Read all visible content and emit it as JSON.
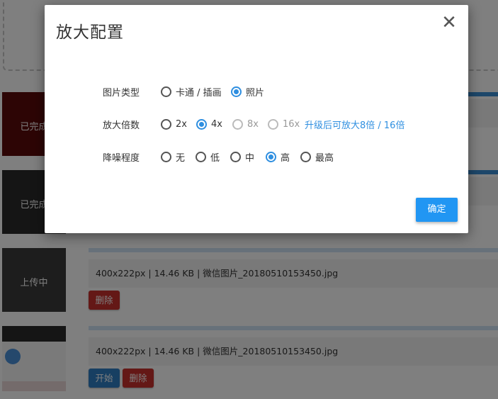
{
  "dialog": {
    "title": "放大配置",
    "close_icon": "close-icon",
    "confirm_label": "确定",
    "rows": {
      "type": {
        "label": "图片类型",
        "options": [
          {
            "text": "卡通 / 插画",
            "checked": false,
            "disabled": false
          },
          {
            "text": "照片",
            "checked": true,
            "disabled": false
          }
        ]
      },
      "scale": {
        "label": "放大倍数",
        "options": [
          {
            "text": "2x",
            "checked": false,
            "disabled": false
          },
          {
            "text": "4x",
            "checked": true,
            "disabled": false
          },
          {
            "text": "8x",
            "checked": false,
            "disabled": true
          },
          {
            "text": "16x",
            "checked": false,
            "disabled": true
          }
        ],
        "upgrade_note": "升级后可放大8倍 / 16倍"
      },
      "noise": {
        "label": "降噪程度",
        "options": [
          {
            "text": "无",
            "checked": false,
            "disabled": false
          },
          {
            "text": "低",
            "checked": false,
            "disabled": false
          },
          {
            "text": "中",
            "checked": false,
            "disabled": false
          },
          {
            "text": "高",
            "checked": true,
            "disabled": false
          },
          {
            "text": "最高",
            "checked": false,
            "disabled": false
          }
        ]
      }
    }
  },
  "files": [
    {
      "status": "已完成"
    },
    {
      "status": "已完成"
    },
    {
      "status": "上传中",
      "info": "400x222px | 14.46 KB | 微信图片_20180510153450.jpg",
      "delete_label": "删除"
    },
    {
      "info": "400x222px | 14.46 KB | 微信图片_20180510153450.jpg",
      "start_label": "开始",
      "delete_label": "删除"
    }
  ],
  "colors": {
    "accent": "#2196f3",
    "danger": "#c9302c",
    "link": "#2f8fe0"
  }
}
